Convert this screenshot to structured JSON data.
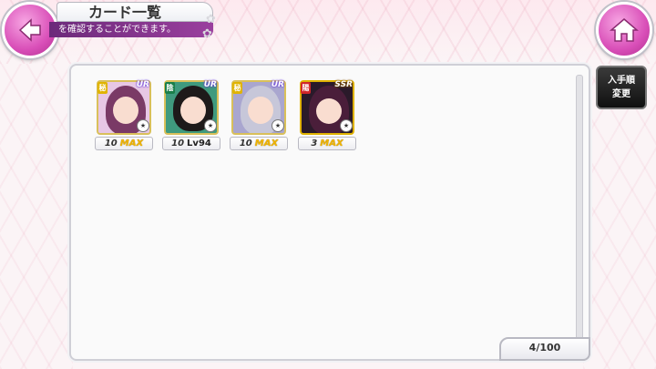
{
  "header": {
    "title": "カード一覧",
    "subtitle": "を確認することができます。"
  },
  "sort_button": {
    "line1": "入手順",
    "line2": "変更"
  },
  "cards": [
    {
      "rarity": "UR",
      "attr_icon": "秘",
      "level": "10",
      "status": "MAX",
      "colors": {
        "hair": "#7a3a66",
        "bg": "#e7c7e5",
        "attr": "#e0b300"
      }
    },
    {
      "rarity": "UR",
      "attr_icon": "陰",
      "level": "10",
      "status": "Lv94",
      "colors": {
        "hair": "#1e1a1a",
        "bg": "#3f9a7e",
        "attr": "#1a7f4a"
      }
    },
    {
      "rarity": "UR",
      "attr_icon": "秘",
      "level": "10",
      "status": "MAX",
      "colors": {
        "hair": "#c7c7d9",
        "bg": "#a9a6cf",
        "attr": "#e0b300"
      }
    },
    {
      "rarity": "SSR",
      "attr_icon": "陽",
      "level": "3",
      "status": "MAX",
      "colors": {
        "hair": "#4a1e3a",
        "bg": "#2a1a2a",
        "attr": "#d0262a"
      }
    }
  ],
  "inventory": {
    "count": "4/100"
  },
  "colors": {
    "accent": "#d94fb8",
    "subtitle_bar": "#7a327f",
    "max_gold": "#f0b400"
  }
}
